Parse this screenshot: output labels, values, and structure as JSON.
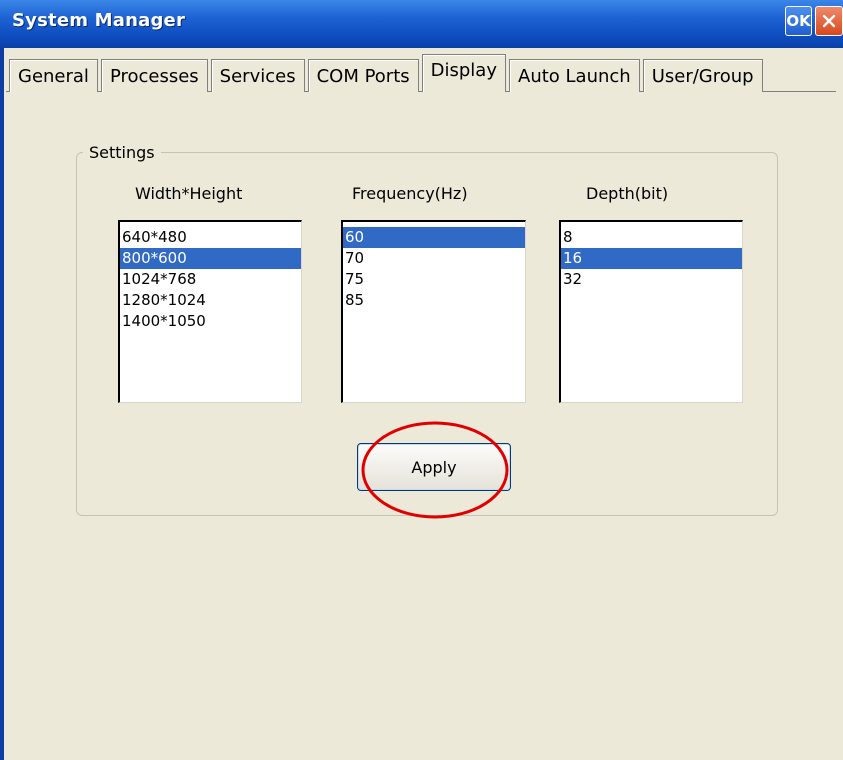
{
  "window": {
    "title": "System Manager",
    "ok_label": "OK"
  },
  "tabs": [
    {
      "label": "General",
      "active": false
    },
    {
      "label": "Processes",
      "active": false
    },
    {
      "label": "Services",
      "active": false
    },
    {
      "label": "COM Ports",
      "active": false
    },
    {
      "label": "Display",
      "active": true
    },
    {
      "label": "Auto Launch",
      "active": false
    },
    {
      "label": "User/Group",
      "active": false
    }
  ],
  "settings": {
    "group_label": "Settings",
    "resolution": {
      "label": "Width*Height",
      "items": [
        "640*480",
        "800*600",
        "1024*768",
        "1280*1024",
        "1400*1050"
      ],
      "selected": "800*600"
    },
    "frequency": {
      "label": "Frequency(Hz)",
      "items": [
        "60",
        "70",
        "75",
        "85"
      ],
      "selected": "60"
    },
    "depth": {
      "label": "Depth(bit)",
      "items": [
        "8",
        "16",
        "32"
      ],
      "selected": "16"
    },
    "apply_label": "Apply"
  },
  "icons": {
    "close": "close-icon"
  },
  "colors": {
    "titlebar": "#1f64d4",
    "selection": "#316ac5",
    "highlight_ellipse": "#e00000",
    "window_bg": "#ece9d8"
  }
}
